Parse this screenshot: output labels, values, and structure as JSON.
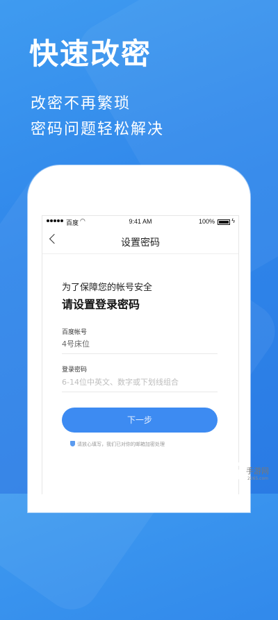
{
  "marketing": {
    "headline": "快速改密",
    "subline1": "改密不再繁琐",
    "subline2": "密码问题轻松解决"
  },
  "statusbar": {
    "carrier": "百度",
    "time": "9:41 AM",
    "battery": "100%"
  },
  "navbar": {
    "title": "设置密码"
  },
  "form": {
    "intro_line1": "为了保障您的帐号安全",
    "intro_line2": "请设置登录密码",
    "account_label": "百度帐号",
    "account_value": "4号床位",
    "password_label": "登录密码",
    "password_placeholder": "6-14位中英文、数字或下划线组合",
    "next_button": "下一步",
    "notice": "请放心填写，我们已对你的邮箱加密处理"
  },
  "watermark": {
    "logo": "2265",
    "tag": "手游网",
    "url": "2265.com"
  }
}
